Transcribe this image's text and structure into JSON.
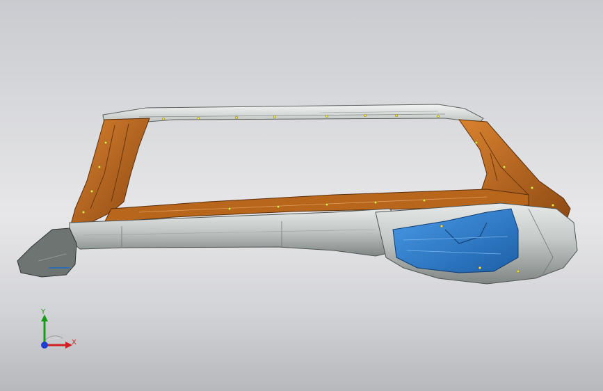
{
  "viewport": {
    "background_top": "#c9cbd0",
    "background_bottom": "#b7b8bd"
  },
  "model": {
    "colors": {
      "frame_orange": "#b8661c",
      "frame_orange_dark": "#8a4712",
      "sill_silver": "#c4c9c8",
      "sill_shadow": "#8f9593",
      "roof_rail": "#dfe3e0",
      "bracket_blue": "#2f82d4",
      "bracket_blue_dark": "#1c5fa8",
      "weld_points": "#f2e64a"
    }
  },
  "triad": {
    "y_label": "Y",
    "x_label": "X",
    "y_color": "#1a9a1a",
    "x_color": "#d02020",
    "z_color": "#1f3fd0"
  }
}
